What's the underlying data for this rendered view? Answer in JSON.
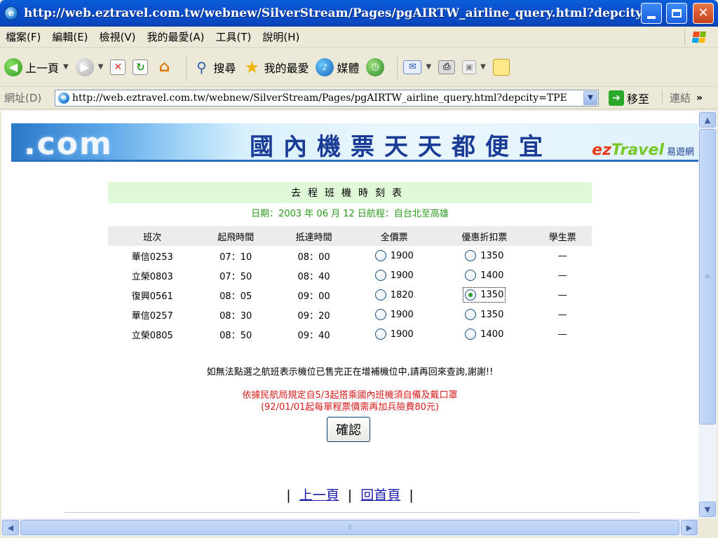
{
  "window": {
    "title": "http://web.eztravel.com.tw/webnew/SilverStream/Pages/pgAIRTW_airline_query.html?depcity=TPE...",
    "app_icon": "ie-icon",
    "buttons": {
      "minimize": "minimize-icon",
      "maximize": "maximize-icon",
      "close": "✕"
    }
  },
  "menu": [
    "檔案(F)",
    "編輯(E)",
    "檢視(V)",
    "我的最愛(A)",
    "工具(T)",
    "說明(H)"
  ],
  "toolbar": {
    "back_label": "上一頁",
    "search_label": "搜尋",
    "favorites_label": "我的最愛",
    "media_label": "媒體"
  },
  "address": {
    "label": "網址(D)",
    "url": "http://web.eztravel.com.tw/webnew/SilverStream/Pages/pgAIRTW_airline_query.html?depcity=TPE",
    "go_label": "移至",
    "links_label": "連結",
    "more": "»"
  },
  "banner": {
    "logo_text": ".com",
    "slogan": "國內機票天天都便宜",
    "brand_ez": "ez",
    "brand_travel": "Travel",
    "brand_cn": "易遊網"
  },
  "schedule": {
    "heading": "去程班機時刻表",
    "date_line": "日期：2003 年 06 月 12 日航程：自台北至高雄",
    "columns": [
      "班次",
      "起飛時間",
      "抵達時間",
      "全價票",
      "優惠折扣票",
      "學生票"
    ],
    "rows": [
      {
        "flight": "華信0253",
        "depart": "07：10",
        "arrive": "08：00",
        "full": "1900",
        "discount": "1350",
        "student": "—"
      },
      {
        "flight": "立榮0803",
        "depart": "07：50",
        "arrive": "08：40",
        "full": "1900",
        "discount": "1400",
        "student": "—"
      },
      {
        "flight": "復興0561",
        "depart": "08：05",
        "arrive": "09：00",
        "full": "1820",
        "discount": "1350",
        "student": "—"
      },
      {
        "flight": "華信0257",
        "depart": "08：30",
        "arrive": "09：20",
        "full": "1900",
        "discount": "1350",
        "student": "—"
      },
      {
        "flight": "立榮0805",
        "depart": "08：50",
        "arrive": "09：40",
        "full": "1900",
        "discount": "1400",
        "student": "—"
      }
    ],
    "selected": {
      "row": 2,
      "column": "discount"
    }
  },
  "notice": "如無法點選之航班表示機位已售完正在增補機位中,請再回來查詢,謝謝!!",
  "regulation_line1": "依據民航局規定自5/3起搭乘國內班機須自備及戴口罩",
  "regulation_line2": "(92/01/01起每單程票價需再加兵險費80元)",
  "confirm_label": "確認",
  "nav": {
    "prev": "上一頁",
    "home": "回首頁",
    "pipe": "|"
  },
  "colors": {
    "accent": "#0a5ed8",
    "notice_red": "#d41a1a",
    "date_green": "#2a9a1a",
    "heading_bg": "#dff8d8"
  }
}
